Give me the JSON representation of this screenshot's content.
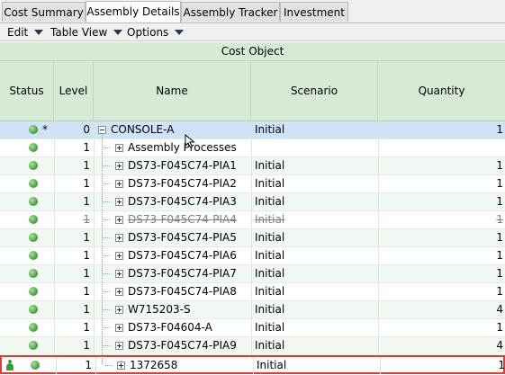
{
  "tabs": [
    {
      "label": "Cost Summary",
      "active": false
    },
    {
      "label": "Assembly Details",
      "active": true
    },
    {
      "label": "Assembly Tracker",
      "active": false
    },
    {
      "label": "Investment",
      "active": false
    }
  ],
  "menus": [
    "Edit",
    "Table View",
    "Options"
  ],
  "table": {
    "group_header": "Cost Object",
    "columns": [
      "Status",
      "Level",
      "Name",
      "Scenario",
      "Quantity"
    ],
    "rows": [
      {
        "level": "0",
        "name": "CONSOLE-A",
        "scenario": "Initial",
        "quantity": "1",
        "status_icon": "green-circle-icon",
        "marker": "*"
      },
      {
        "level": "1",
        "name": "Assembly Processes",
        "scenario": "",
        "quantity": "",
        "status_icon": "green-circle-icon",
        "marker": ""
      },
      {
        "level": "1",
        "name": "DS73-F045C74-PIA1",
        "scenario": "Initial",
        "quantity": "1",
        "status_icon": "green-circle-icon",
        "marker": ""
      },
      {
        "level": "1",
        "name": "DS73-F045C74-PIA2",
        "scenario": "Initial",
        "quantity": "1",
        "status_icon": "green-circle-icon",
        "marker": ""
      },
      {
        "level": "1",
        "name": "DS73-F045C74-PIA3",
        "scenario": "Initial",
        "quantity": "1",
        "status_icon": "green-circle-icon",
        "marker": ""
      },
      {
        "level": "1",
        "name": "DS73-F045C74-PIA4",
        "scenario": "Initial",
        "quantity": "1",
        "status_icon": "green-circle-icon",
        "marker": "",
        "struck": true
      },
      {
        "level": "1",
        "name": "DS73-F045C74-PIA5",
        "scenario": "Initial",
        "quantity": "1",
        "status_icon": "green-circle-icon",
        "marker": ""
      },
      {
        "level": "1",
        "name": "DS73-F045C74-PIA6",
        "scenario": "Initial",
        "quantity": "1",
        "status_icon": "green-circle-icon",
        "marker": ""
      },
      {
        "level": "1",
        "name": "DS73-F045C74-PIA7",
        "scenario": "Initial",
        "quantity": "1",
        "status_icon": "green-circle-icon",
        "marker": ""
      },
      {
        "level": "1",
        "name": "DS73-F045C74-PIA8",
        "scenario": "Initial",
        "quantity": "1",
        "status_icon": "green-circle-icon",
        "marker": ""
      },
      {
        "level": "1",
        "name": "W715203-S",
        "scenario": "Initial",
        "quantity": "4",
        "status_icon": "green-circle-icon",
        "marker": ""
      },
      {
        "level": "1",
        "name": "DS73-F04604-A",
        "scenario": "Initial",
        "quantity": "1",
        "status_icon": "green-circle-icon",
        "marker": ""
      },
      {
        "level": "1",
        "name": "DS73-F045C74-PIA9",
        "scenario": "Initial",
        "quantity": "4",
        "status_icon": "green-circle-icon",
        "marker": ""
      },
      {
        "level": "1",
        "name": "1372658",
        "scenario": "Initial",
        "quantity": "1",
        "status_icon": "green-circle-icon",
        "marker": "person-icon",
        "highlighted": true
      }
    ]
  },
  "colors": {
    "header_bg": "#d6ead6",
    "alt_row_bg": "#f1f8f1",
    "selected_row_bg": "#cfe2f7",
    "highlight_border": "#e03c3c",
    "status_green": "#3d9a3a"
  }
}
